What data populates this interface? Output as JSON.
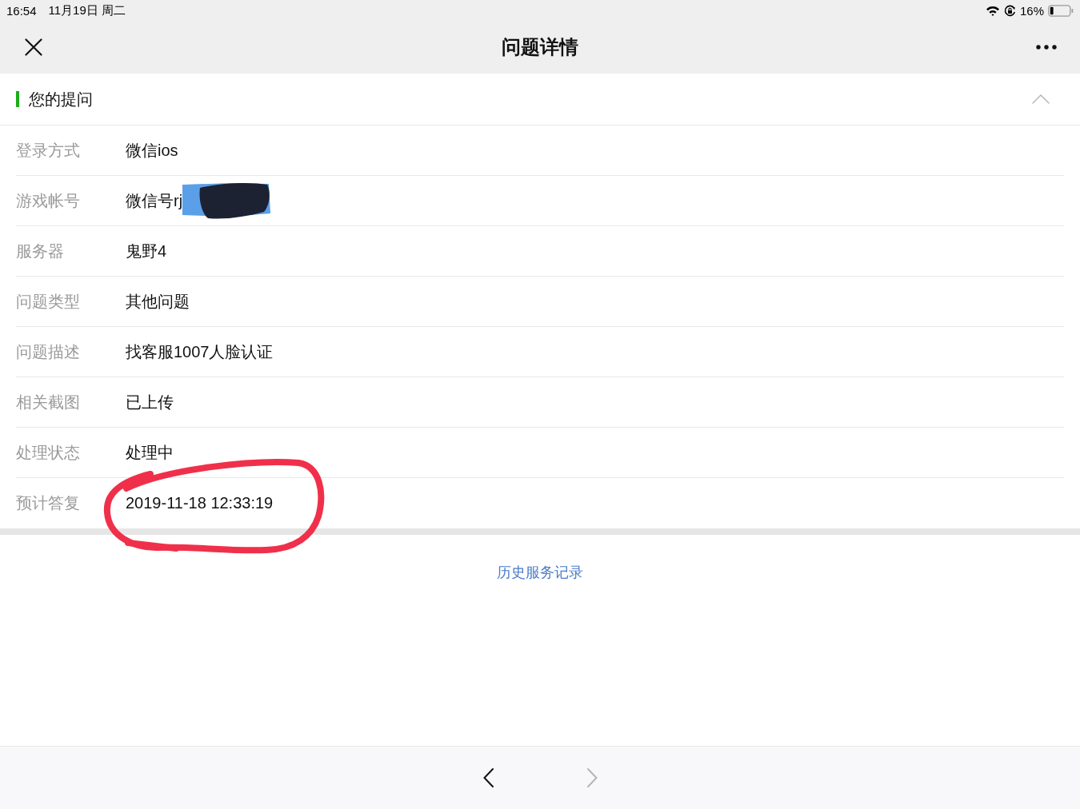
{
  "status_bar": {
    "time": "16:54",
    "date": "11月19日 周二",
    "battery_percent": "16%"
  },
  "nav_bar": {
    "title": "问题详情"
  },
  "section": {
    "title": "您的提问",
    "expanded": true
  },
  "details": [
    {
      "label": "登录方式",
      "value": "微信ios",
      "redacted": false,
      "circled": false
    },
    {
      "label": "游戏帐号",
      "value": "微信号rj",
      "redacted": true,
      "circled": false
    },
    {
      "label": "服务器",
      "value": "鬼野4",
      "redacted": false,
      "circled": false
    },
    {
      "label": "问题类型",
      "value": "其他问题",
      "redacted": false,
      "circled": false
    },
    {
      "label": "问题描述",
      "value": "找客服1007人脸认证",
      "redacted": false,
      "circled": false
    },
    {
      "label": "相关截图",
      "value": "已上传",
      "redacted": false,
      "circled": false
    },
    {
      "label": "处理状态",
      "value": "处理中",
      "redacted": false,
      "circled": false
    },
    {
      "label": "预计答复",
      "value": "2019-11-18 12:33:19",
      "redacted": false,
      "circled": true
    }
  ],
  "history_link": "历史服务记录",
  "toolbar": {
    "back_disabled": false,
    "forward_disabled": true
  }
}
